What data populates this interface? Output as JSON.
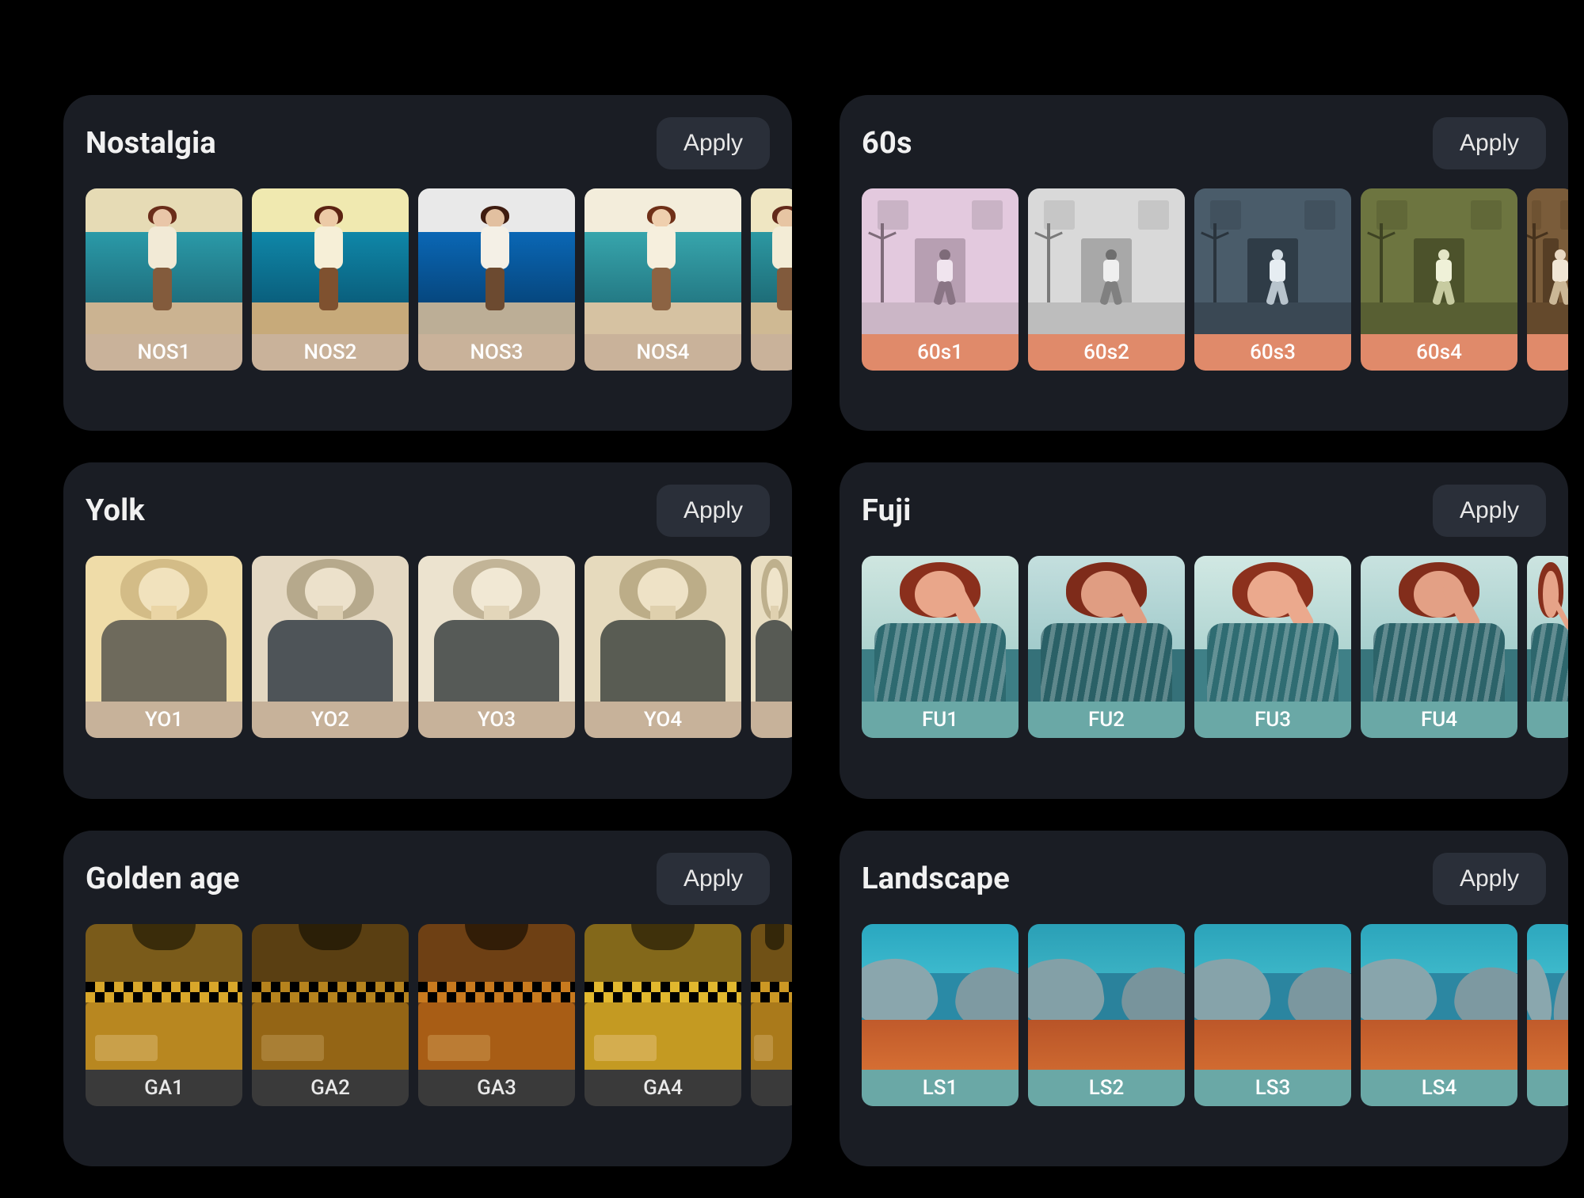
{
  "apply_label": "Apply",
  "packs": [
    {
      "id": "nostalgia",
      "title": "Nostalgia",
      "label_color": "#c9b29a",
      "label_text_color": "#ffffff",
      "scene": "nostalgia",
      "variants": [
        "nos1",
        "nos2",
        "nos3",
        "nos4",
        "nos5"
      ],
      "thumbs": [
        {
          "label": "NOS1"
        },
        {
          "label": "NOS2"
        },
        {
          "label": "NOS3"
        },
        {
          "label": "NOS4"
        },
        {
          "label": ""
        }
      ]
    },
    {
      "id": "sixties",
      "title": "60s",
      "label_color": "#e08a6a",
      "label_text_color": "#ffffff",
      "scene": "sixties",
      "variants": [
        "s1",
        "s2",
        "s3",
        "s4",
        "s5"
      ],
      "thumbs": [
        {
          "label": "60s1"
        },
        {
          "label": "60s2"
        },
        {
          "label": "60s3"
        },
        {
          "label": "60s4"
        },
        {
          "label": ""
        }
      ]
    },
    {
      "id": "yolk",
      "title": "Yolk",
      "label_color": "#c7b29a",
      "label_text_color": "#ffffff",
      "scene": "yolk",
      "variants": [
        "y1",
        "y2",
        "y3",
        "y4",
        "y5"
      ],
      "thumbs": [
        {
          "label": "YO1"
        },
        {
          "label": "YO2"
        },
        {
          "label": "YO3"
        },
        {
          "label": "YO4"
        },
        {
          "label": ""
        }
      ]
    },
    {
      "id": "fuji",
      "title": "Fuji",
      "label_color": "#6aa8a6",
      "label_text_color": "#ffffff",
      "scene": "fuji",
      "variants": [
        "f1",
        "f2",
        "f3",
        "f4",
        "f5"
      ],
      "thumbs": [
        {
          "label": "FU1"
        },
        {
          "label": "FU2"
        },
        {
          "label": "FU3"
        },
        {
          "label": "FU4"
        },
        {
          "label": ""
        }
      ]
    },
    {
      "id": "golden-age",
      "title": "Golden age",
      "label_color": "#3a3a3a",
      "label_text_color": "#e8e8e8",
      "scene": "ga",
      "variants": [
        "g1",
        "g2",
        "g3",
        "g4",
        "g5"
      ],
      "thumbs": [
        {
          "label": "GA1"
        },
        {
          "label": "GA2"
        },
        {
          "label": "GA3"
        },
        {
          "label": "GA4"
        },
        {
          "label": ""
        }
      ]
    },
    {
      "id": "landscape",
      "title": "Landscape",
      "label_color": "#6aa8a6",
      "label_text_color": "#ffffff",
      "scene": "ls",
      "variants": [
        "l1",
        "l2",
        "l3",
        "l4",
        "l5"
      ],
      "thumbs": [
        {
          "label": "LS1"
        },
        {
          "label": "LS2"
        },
        {
          "label": "LS3"
        },
        {
          "label": "LS4"
        },
        {
          "label": ""
        }
      ]
    }
  ]
}
